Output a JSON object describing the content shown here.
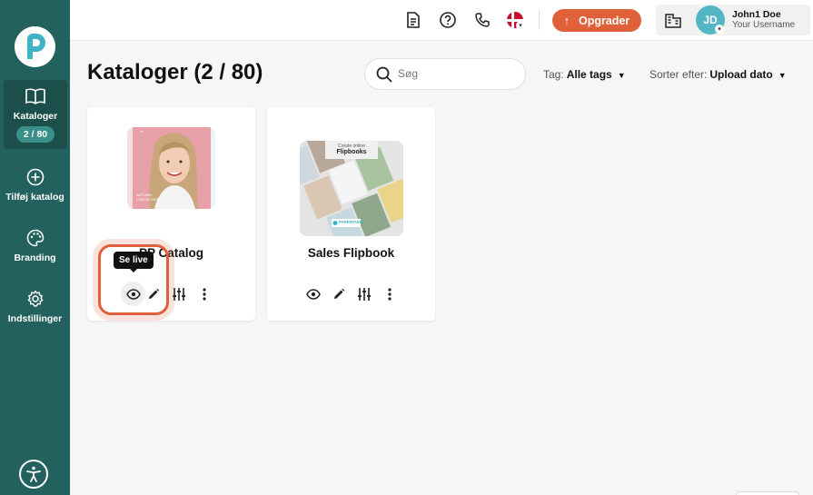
{
  "sidebar": {
    "items": [
      {
        "label": "Kataloger",
        "badge": "2 / 80",
        "icon": "book-open-icon",
        "active": true
      },
      {
        "label": "Tilføj katalog",
        "icon": "plus-circle-icon"
      },
      {
        "label": "Branding",
        "icon": "palette-icon"
      },
      {
        "label": "Indstillinger",
        "icon": "gear-icon"
      }
    ]
  },
  "header": {
    "upgrade_label": "Opgrader",
    "user_initials": "JD",
    "user_name": "John1 Doe",
    "user_sub": "Your Username"
  },
  "main": {
    "title": "Kataloger (2 / 80)",
    "search_placeholder": "Søg",
    "tag_label": "Tag:",
    "tag_value": "Alle tags",
    "sort_label": "Sorter efter:",
    "sort_value": "Upload dato",
    "tooltip": "Se live",
    "catalogs": [
      {
        "title": "PP Catalog",
        "cover_text": "AUTUMN COLLECTION"
      },
      {
        "title": "Sales Flipbook",
        "cover_title_line1": "Create online",
        "cover_title_line2": "Flipbooks",
        "cover_brand": "PAPERTURN"
      }
    ]
  },
  "colors": {
    "sidebar": "#23615e",
    "accent": "#e0603a",
    "avatar": "#52b6c4"
  }
}
